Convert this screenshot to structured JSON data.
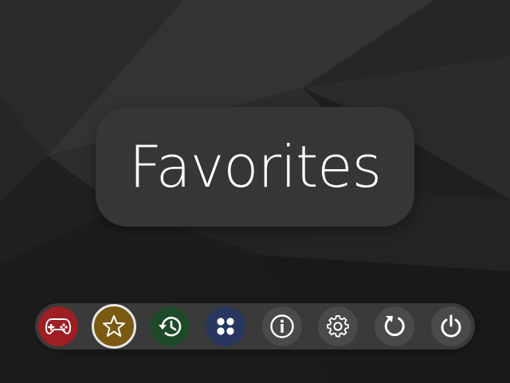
{
  "screen": {
    "title": "Favorites"
  },
  "dock": {
    "items": [
      {
        "id": "games",
        "icon": "gamepad-icon",
        "color": "#9e1e24"
      },
      {
        "id": "favorites",
        "icon": "star-icon",
        "color": "#7a5a12",
        "selected": true
      },
      {
        "id": "history",
        "icon": "history-icon",
        "color": "#1f4a2a"
      },
      {
        "id": "collections",
        "icon": "grid-dots-icon",
        "color": "#27375f"
      },
      {
        "id": "info",
        "icon": "info-icon",
        "color": "#4a4a4a"
      },
      {
        "id": "settings",
        "icon": "gear-icon",
        "color": "#4a4a4a"
      },
      {
        "id": "restart",
        "icon": "restart-icon",
        "color": "#4a4a4a"
      },
      {
        "id": "power",
        "icon": "power-icon",
        "color": "#4a4a4a"
      }
    ]
  }
}
